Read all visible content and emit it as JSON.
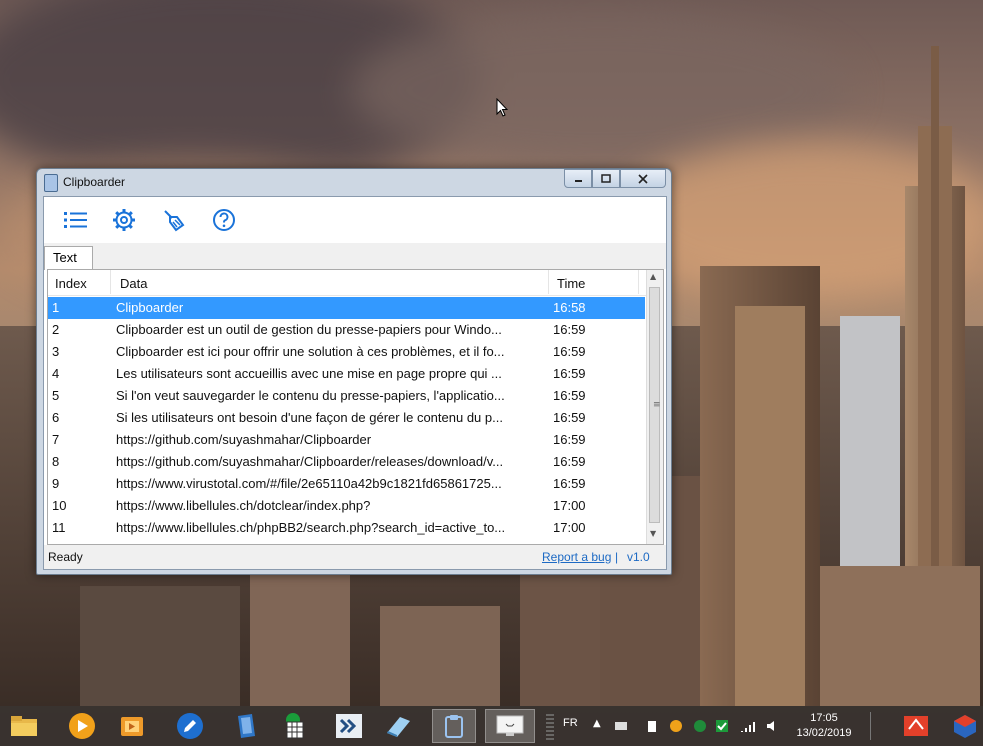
{
  "window": {
    "title": "Clipboarder",
    "toolbar": [
      "list-icon",
      "gear-icon",
      "broom-icon",
      "help-icon"
    ],
    "tab": "Text",
    "columns": {
      "index": "Index",
      "data": "Data",
      "time": "Time"
    },
    "rows": [
      {
        "index": "1",
        "data": "Clipboarder",
        "time": "16:58",
        "selected": true
      },
      {
        "index": "2",
        "data": "Clipboarder est un outil de gestion du presse-papiers pour Windo...",
        "time": "16:59"
      },
      {
        "index": "3",
        "data": "Clipboarder est ici pour offrir une solution à ces problèmes, et il fo...",
        "time": "16:59"
      },
      {
        "index": "4",
        "data": "Les utilisateurs sont accueillis avec une mise en page propre qui ...",
        "time": "16:59"
      },
      {
        "index": "5",
        "data": "Si l'on veut sauvegarder le contenu du presse-papiers, l'applicatio...",
        "time": "16:59"
      },
      {
        "index": "6",
        "data": "Si les utilisateurs ont besoin d'une façon de gérer le contenu du p...",
        "time": "16:59"
      },
      {
        "index": "7",
        "data": "https://github.com/suyashmahar/Clipboarder",
        "time": "16:59"
      },
      {
        "index": "8",
        "data": "https://github.com/suyashmahar/Clipboarder/releases/download/v...",
        "time": "16:59"
      },
      {
        "index": "9",
        "data": "https://www.virustotal.com/#/file/2e65110a42b9c1821fd65861725...",
        "time": "16:59"
      },
      {
        "index": "10",
        "data": "https://www.libellules.ch/dotclear/index.php?",
        "time": "17:00"
      },
      {
        "index": "11",
        "data": "https://www.libellules.ch/phpBB2/search.php?search_id=active_to...",
        "time": "17:00"
      }
    ],
    "status": {
      "ready": "Ready",
      "report_link": "Report a bug",
      "separator": "|",
      "version": "v1.0"
    }
  },
  "taskbar": {
    "language": "FR",
    "clock_time": "17:05",
    "clock_date": "13/02/2019"
  },
  "colors": {
    "selection": "#3399ff",
    "icon_blue": "#1a73d9",
    "link": "#1d6ac4"
  }
}
